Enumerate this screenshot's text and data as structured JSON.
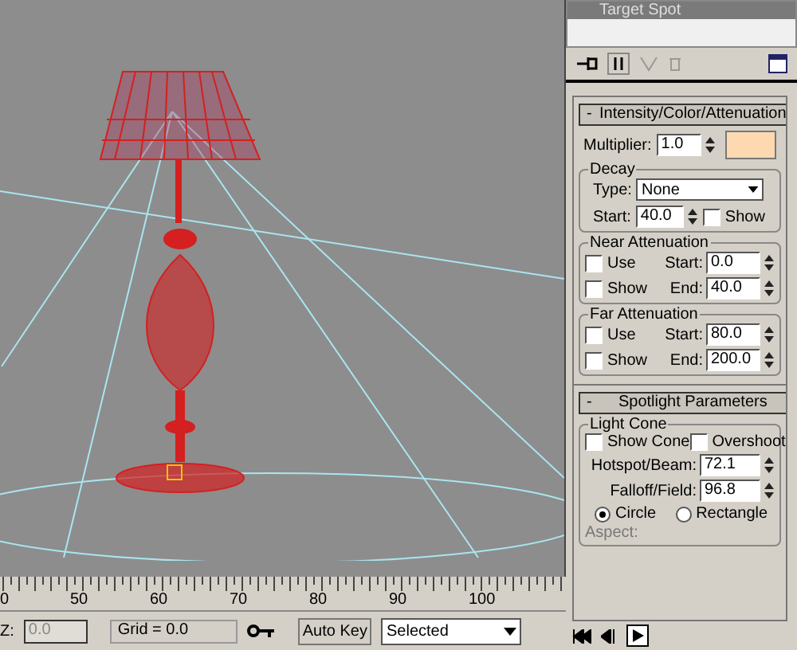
{
  "command_panel": {
    "list_items": [
      {
        "label": "Target Spot",
        "selected": true
      }
    ],
    "intensity": {
      "toggle": "-",
      "title": "Intensity/Color/Attenuation",
      "multiplier_label": "Multiplier:",
      "multiplier": "1.0",
      "color": "#fcd9b0",
      "decay": {
        "title": "Decay",
        "type_label": "Type:",
        "type": "None",
        "start_label": "Start:",
        "start": "40.0",
        "show": {
          "label": "Show",
          "checked": false
        }
      },
      "attenuation": [
        {
          "title": "Near Attenuation",
          "use": {
            "label": "Use",
            "checked": false
          },
          "show": {
            "label": "Show",
            "checked": false
          },
          "start_label": "Start:",
          "start": "0.0",
          "end_label": "End:",
          "end": "40.0"
        },
        {
          "title": "Far Attenuation",
          "use": {
            "label": "Use",
            "checked": false
          },
          "show": {
            "label": "Show",
            "checked": false
          },
          "start_label": "Start:",
          "start": "80.0",
          "end_label": "End:",
          "end": "200.0"
        }
      ]
    },
    "spotlight": {
      "toggle": "-",
      "title": "Spotlight Parameters",
      "group": "Light Cone",
      "checks": [
        {
          "label": "Show Cone",
          "checked": false
        },
        {
          "label": "Overshoot",
          "checked": false
        }
      ],
      "spinners": [
        {
          "label": "Hotspot/Beam:",
          "value": "72.1"
        },
        {
          "label": "Falloff/Field:",
          "value": "96.8"
        }
      ],
      "shapes": [
        {
          "label": "Circle",
          "selected": true
        },
        {
          "label": "Rectangle",
          "selected": false
        }
      ],
      "aspect_label": "Aspect:"
    }
  },
  "timeline": {
    "ticks": [
      "0",
      "50",
      "60",
      "70",
      "80",
      "90",
      "100"
    ],
    "z_label": "Z:",
    "z_value": "0.0",
    "grid": "Grid = 0.0",
    "auto_key": "Auto Key",
    "key_filter": "Selected"
  }
}
